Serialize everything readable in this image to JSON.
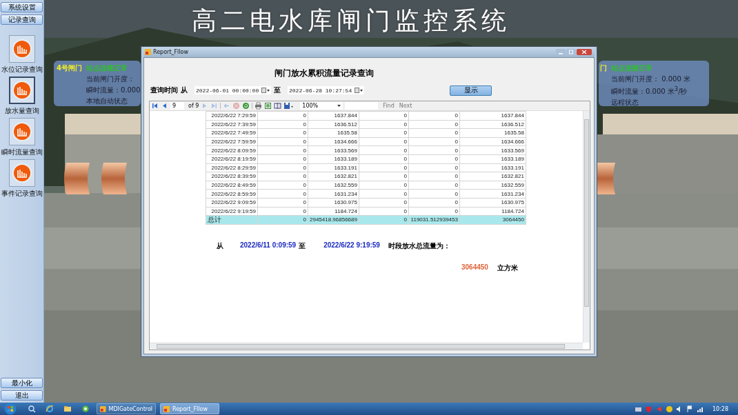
{
  "sidebar": {
    "top_buttons": [
      "系统设置",
      "记录查询"
    ],
    "items": [
      {
        "label": "水位记录查询",
        "selected": false
      },
      {
        "label": "放水量查询",
        "selected": true
      },
      {
        "label": "瞬时流量查询",
        "selected": false
      },
      {
        "label": "事件记录查询",
        "selected": false
      }
    ],
    "bottom_buttons": [
      "最小化",
      "退出"
    ]
  },
  "app_title": "高二电水库闸门监控系统",
  "gate_panels": [
    {
      "name": "4号闸门",
      "status": "站点连接正常",
      "lines": [
        "当前闸门开度：",
        "瞬时流量：0.000",
        "本地自动状态"
      ]
    },
    {
      "name": "门",
      "status": "站点连接正常",
      "lines": [
        "当前闸门开度： 0.000 米",
        "瞬时流量：0.000 米$^{3}$/秒",
        "远程状态"
      ]
    }
  ],
  "dialog": {
    "title": "Report_Fllow",
    "heading": "闸门放水累积流量记录查询",
    "query": {
      "label": "查询时间",
      "from_label": "从",
      "from_value": "2022-06-01 00:00:00",
      "to_label": "至",
      "to_value": "2022-06-28 10:27:54",
      "button": "显示"
    },
    "toolbar": {
      "page": "9",
      "of_pages": "of 9",
      "zoom": "100%",
      "find": "Find",
      "next": "Next",
      "buttons": [
        {
          "kind": "first",
          "disabled": false
        },
        {
          "kind": "prev",
          "disabled": false
        },
        {
          "kind": "pageinput"
        },
        {
          "kind": "next",
          "disabled": true
        },
        {
          "kind": "last",
          "disabled": true
        },
        {
          "kind": "back",
          "disabled": true
        },
        {
          "kind": "stop",
          "disabled": true
        },
        {
          "kind": "refresh",
          "disabled": false
        },
        {
          "kind": "print",
          "disabled": false
        },
        {
          "kind": "layout",
          "disabled": false
        },
        {
          "kind": "pagesetup",
          "disabled": false
        },
        {
          "kind": "export",
          "disabled": false
        }
      ]
    },
    "table": {
      "rows": [
        {
          "kind": "data",
          "cells": [
            "2022/6/22 7:29:59",
            "0",
            "1637.844",
            "0",
            "0",
            "1637.844"
          ]
        },
        {
          "kind": "data",
          "cells": [
            "2022/6/22 7:39:59",
            "0",
            "1636.512",
            "0",
            "0",
            "1636.512"
          ]
        },
        {
          "kind": "data",
          "cells": [
            "2022/6/22 7:49:59",
            "0",
            "1635.58",
            "0",
            "0",
            "1635.58"
          ]
        },
        {
          "kind": "data",
          "cells": [
            "2022/6/22 7:59:59",
            "0",
            "1634.666",
            "0",
            "0",
            "1634.666"
          ]
        },
        {
          "kind": "data",
          "cells": [
            "2022/6/22 8:09:59",
            "0",
            "1633.569",
            "0",
            "0",
            "1633.569"
          ]
        },
        {
          "kind": "data",
          "cells": [
            "2022/6/22 8:19:59",
            "0",
            "1633.189",
            "0",
            "0",
            "1633.189"
          ]
        },
        {
          "kind": "data",
          "cells": [
            "2022/6/22 8:29:59",
            "0",
            "1633.191",
            "0",
            "0",
            "1633.191"
          ]
        },
        {
          "kind": "data",
          "cells": [
            "2022/6/22 8:39:59",
            "0",
            "1632.821",
            "0",
            "0",
            "1632.821"
          ]
        },
        {
          "kind": "data",
          "cells": [
            "2022/6/22 8:49:59",
            "0",
            "1632.559",
            "0",
            "0",
            "1632.559"
          ]
        },
        {
          "kind": "data",
          "cells": [
            "2022/6/22 8:59:59",
            "0",
            "1631.234",
            "0",
            "0",
            "1631.234"
          ]
        },
        {
          "kind": "data",
          "cells": [
            "2022/6/22 9:09:59",
            "0",
            "1630.975",
            "0",
            "0",
            "1630.975"
          ]
        },
        {
          "kind": "data",
          "cells": [
            "2022/6/22 9:19:59",
            "0",
            "1184.724",
            "0",
            "0",
            "1184.724"
          ]
        },
        {
          "kind": "total",
          "cells": [
            "总计",
            "0",
            "2945418.96856689",
            "0",
            "119031.512939453",
            "3064450"
          ]
        }
      ]
    },
    "summary": {
      "from_label": "从",
      "start": "2022/6/11 0:09:59",
      "to_label": "至",
      "end": "2022/6/22 9:19:59",
      "total_label": "时段放水总流量为：",
      "total": "3064450",
      "unit": "立方米"
    }
  },
  "taskbar": {
    "pinned": [
      {
        "kind": "search"
      },
      {
        "kind": "browser"
      },
      {
        "kind": "folder"
      },
      {
        "kind": "app"
      }
    ],
    "tasks": [
      {
        "label": "MDIGateControl",
        "selected": false
      },
      {
        "label": "Report_Fllow",
        "selected": true
      }
    ],
    "clock": "10:28"
  }
}
